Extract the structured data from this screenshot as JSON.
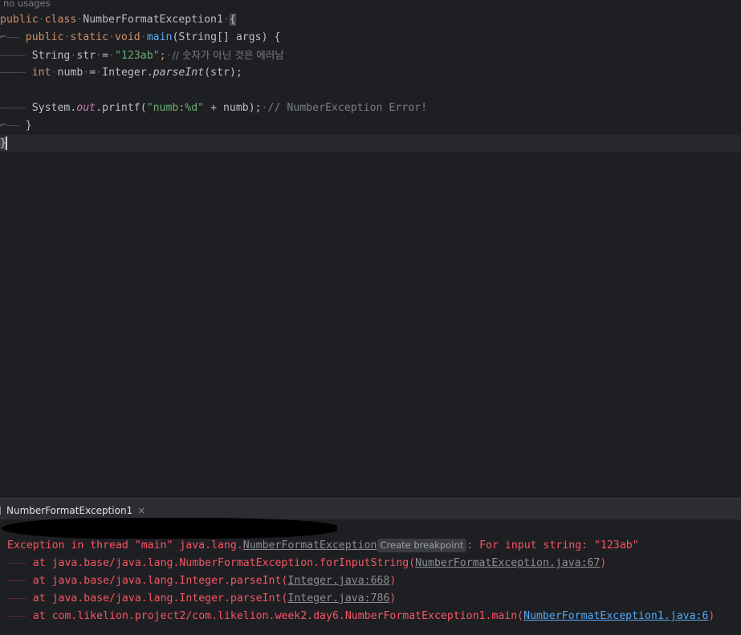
{
  "editor": {
    "usages_hint": "no usages",
    "lines": {
      "l1": {
        "kw1": "public",
        "kw2": "class",
        "name": "NumberFormatException1",
        "brace": "{"
      },
      "l2": {
        "kw1": "public",
        "kw2": "static",
        "kw3": "void",
        "method": "main",
        "params": "(String[] args) {"
      },
      "l3": {
        "type": "String",
        "var": "str",
        "eq": "=",
        "value": "\"123ab\"",
        "semi": ";",
        "comment": "// 숫자가 아닌 것은 에러남"
      },
      "l4": {
        "kw": "int",
        "var": "numb",
        "eq": "=",
        "cls": "Integer.",
        "method": "parseInt",
        "args": "(str);"
      },
      "l6": {
        "obj": "System.",
        "field": "out",
        "call": ".printf(",
        "fmt": "\"numb:%d\"",
        "rest": " + numb);",
        "comment": "// NumberException Error!"
      },
      "l7": {
        "brace": "}"
      },
      "l8": {
        "brace": "}"
      }
    }
  },
  "run_panel": {
    "tab_label": "NumberFormatException1",
    "close_glyph": "×"
  },
  "console": {
    "exception_prefix": "Exception in thread \"main\" java.lang.",
    "exception_class": "NumberFormatException",
    "breakpoint_hint": "Create breakpoint",
    "exception_suffix": ": For input string: \"123ab\"",
    "stack": [
      {
        "text": "at java.base/java.lang.NumberFormatException.forInputString(",
        "link": "NumberFormatException.java:67",
        "end": ")"
      },
      {
        "text": "at java.base/java.lang.Integer.parseInt(",
        "link": "Integer.java:668",
        "end": ")"
      },
      {
        "text": "at java.base/java.lang.Integer.parseInt(",
        "link": "Integer.java:786",
        "end": ")"
      },
      {
        "text": "at com.likelion.project2/com.likelion.week2.day6.NumberFormatException1.main(",
        "link": "NumberFormatException1.java:6",
        "end": ")"
      }
    ]
  },
  "colors": {
    "keyword": "#cf8e6d",
    "string": "#6aab73",
    "error": "#f75464",
    "link_active": "#56a8f5",
    "background": "#1e1f22"
  }
}
